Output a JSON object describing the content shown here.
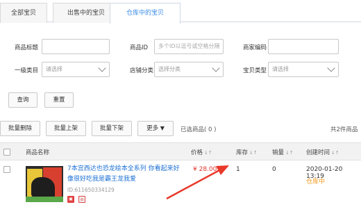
{
  "tabs": [
    {
      "label": "全部宝贝"
    },
    {
      "label": "出售中的宝贝"
    },
    {
      "label": "仓库中的宝贝"
    }
  ],
  "filters": {
    "title_label": "商品标题",
    "id_label": "商品ID",
    "id_placeholder": "多个ID以逗号或空格分隔",
    "code_label": "商家编码",
    "category_label": "一级类目",
    "category_value": "请选择",
    "shop_cat_label": "店铺分类",
    "shop_cat_value": "选择分类",
    "type_label": "宝贝类型",
    "type_value": "请选择",
    "query_button": "查询",
    "reset_button": "重置"
  },
  "toolbar": {
    "batch_delete": "批量删除",
    "batch_list": "批量上架",
    "batch_delist": "批量下架",
    "more": "更多",
    "selected": "已选商品( 0 )",
    "total": "共2件商品"
  },
  "table": {
    "headers": {
      "name": "商品名称",
      "price": "价格",
      "stock": "库存",
      "sales": "销量",
      "created": "创建时间"
    },
    "rows": [
      {
        "title": "7本宫西达也恐龙绘本全系列 你看起来好像很好吃我是霸王龙我爱",
        "id": "ID:611650334129",
        "price": "¥ 28.00",
        "stock": "1",
        "sales": "0",
        "created": "2020-01-20 13:19",
        "status": "仓库中"
      }
    ]
  },
  "colors": {
    "accent": "#3d8de6",
    "price": "#e0322c",
    "status": "#f29b1f",
    "arrow": "#e8392b"
  }
}
